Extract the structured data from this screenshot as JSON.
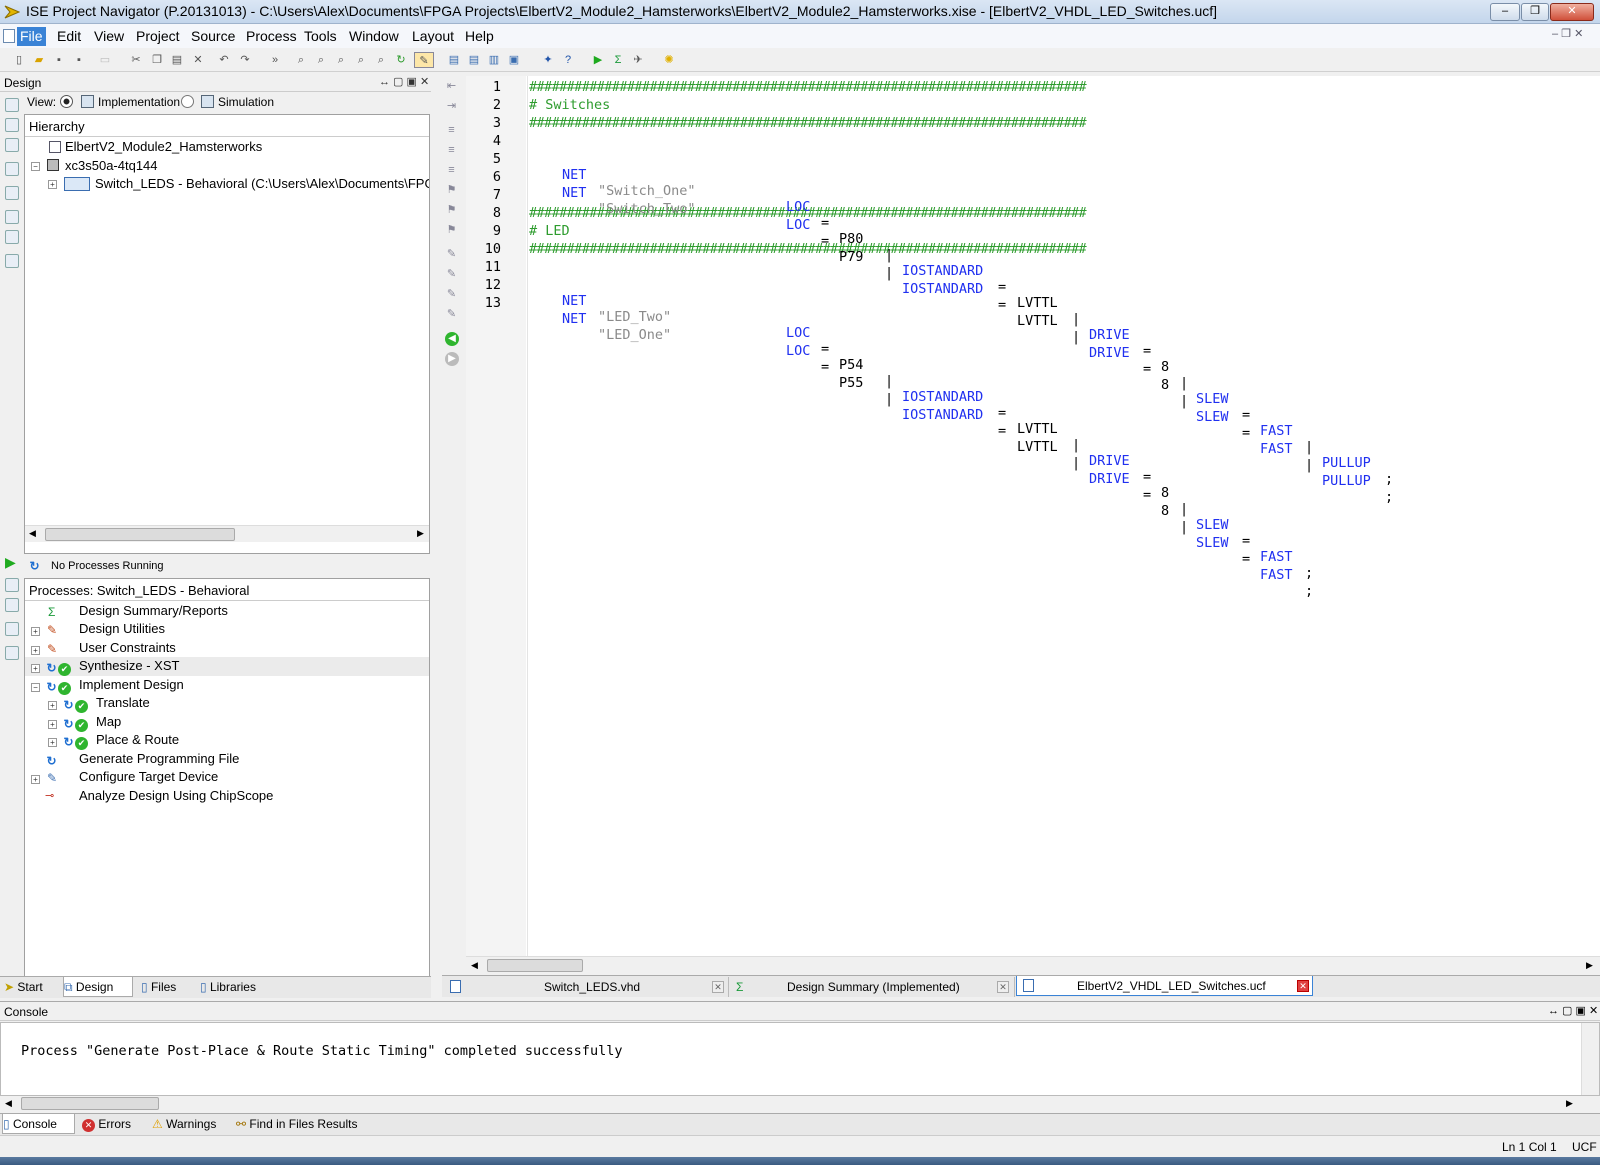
{
  "window": {
    "title": "ISE Project Navigator (P.20131013) - C:\\Users\\Alex\\Documents\\FPGA Projects\\ElbertV2_Module2_Hamsterworks\\ElbertV2_Module2_Hamsterworks.xise - [ElbertV2_VHDL_LED_Switches.ucf]"
  },
  "menu": [
    "File",
    "Edit",
    "View",
    "Project",
    "Source",
    "Process",
    "Tools",
    "Window",
    "Layout",
    "Help"
  ],
  "design": {
    "panel_title": "Design",
    "view_label": "View:",
    "view_options": [
      "Implementation",
      "Simulation"
    ],
    "hierarchy_title": "Hierarchy",
    "tree": [
      "ElbertV2_Module2_Hamsterworks",
      "xc3s50a-4tq144",
      "Switch_LEDS - Behavioral (C:\\Users\\Alex\\Documents\\FPGA"
    ]
  },
  "processes": {
    "status": "No Processes Running",
    "title": "Processes: Switch_LEDS - Behavioral",
    "items": [
      "Design Summary/Reports",
      "Design Utilities",
      "User Constraints",
      "Synthesize - XST",
      "Implement Design",
      "Translate",
      "Map",
      "Place & Route",
      "Generate Programming File",
      "Configure Target Device",
      "Analyze Design Using ChipScope"
    ]
  },
  "left_tabs": [
    "Start",
    "Design",
    "Files",
    "Libraries"
  ],
  "editor": {
    "line_numbers": [
      "1",
      "2",
      "3",
      "4",
      "5",
      "6",
      "7",
      "8",
      "9",
      "10",
      "11",
      "12",
      "13"
    ],
    "hash_line": "##########################################################################",
    "comment_switches": "# Switches",
    "comment_led": "# LED",
    "rows": [
      {
        "name": "\"Switch_One\"",
        "pin": "P80",
        "pullup": true
      },
      {
        "name": "\"Switch_Two\"",
        "pin": "P79",
        "pullup": true
      },
      {
        "name": "\"LED_Two\"",
        "pin": "P54",
        "pullup": false
      },
      {
        "name": "\"LED_One\"",
        "pin": "P55",
        "pullup": false
      }
    ],
    "tokens": {
      "net": "NET",
      "loc": "LOC",
      "iostd": "IOSTANDARD",
      "lvttl": "LVTTL",
      "drive": "DRIVE",
      "eight": "8",
      "slew": "SLEW",
      "fast": "FAST",
      "pullup": "PULLUP",
      "eq": "=",
      "bar": "|",
      "semi": ";"
    }
  },
  "doc_tabs": [
    "Switch_LEDS.vhd",
    "Design Summary (Implemented)",
    "ElbertV2_VHDL_LED_Switches.ucf"
  ],
  "console": {
    "title": "Console",
    "message": "Process \"Generate Post-Place & Route Static Timing\" completed successfully",
    "tabs": [
      "Console",
      "Errors",
      "Warnings",
      "Find in Files Results"
    ]
  },
  "status": {
    "position": "Ln 1 Col 1",
    "filetype": "UCF"
  },
  "colors": {
    "comment": "#2e9c2e",
    "keyword": "#2030f0",
    "string": "#8a8a8a",
    "accent": "#3a83d6"
  },
  "icons": [
    "file-icon",
    "new-icon",
    "open-icon",
    "save-icon",
    "cut-icon",
    "copy-icon",
    "paste-icon",
    "delete-icon",
    "undo-icon",
    "redo-icon",
    "zoom-icon",
    "run-icon",
    "sigma-icon",
    "settings-icon",
    "bulb-icon",
    "check-icon",
    "refresh-icon",
    "close-icon"
  ]
}
